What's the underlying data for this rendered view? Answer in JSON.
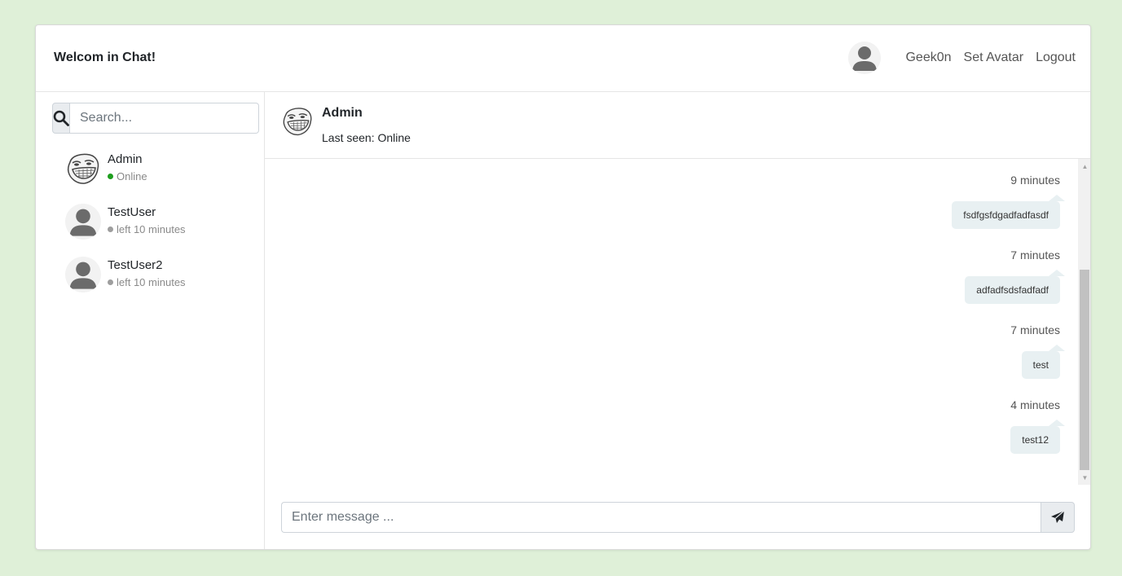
{
  "header": {
    "title": "Welcom in Chat!",
    "username": "Geek0n",
    "set_avatar_label": "Set Avatar",
    "logout_label": "Logout"
  },
  "search": {
    "placeholder": "Search..."
  },
  "users": [
    {
      "name": "Admin",
      "status": "Online",
      "status_color": "#1e9e1e",
      "avatar": "troll-face"
    },
    {
      "name": "TestUser",
      "status": "left 10 minutes",
      "status_color": "#9e9e9e",
      "avatar": "default-user"
    },
    {
      "name": "TestUser2",
      "status": "left 10 minutes",
      "status_color": "#9e9e9e",
      "avatar": "default-user"
    }
  ],
  "chat": {
    "name": "Admin",
    "last_seen": "Last seen: Online",
    "messages": [
      {
        "time": "9 minutes",
        "text": "fsdfgsfdgadfadfasdf"
      },
      {
        "time": "7 minutes",
        "text": "adfadfsdsfadfadf"
      },
      {
        "time": "7 minutes",
        "text": "test"
      },
      {
        "time": "4 minutes",
        "text": "test12"
      }
    ]
  },
  "composer": {
    "placeholder": "Enter message ..."
  },
  "colors": {
    "page_background": "#dff0d8",
    "bubble": "#e8f0f2",
    "online": "#1e9e1e",
    "offline": "#9e9e9e"
  }
}
